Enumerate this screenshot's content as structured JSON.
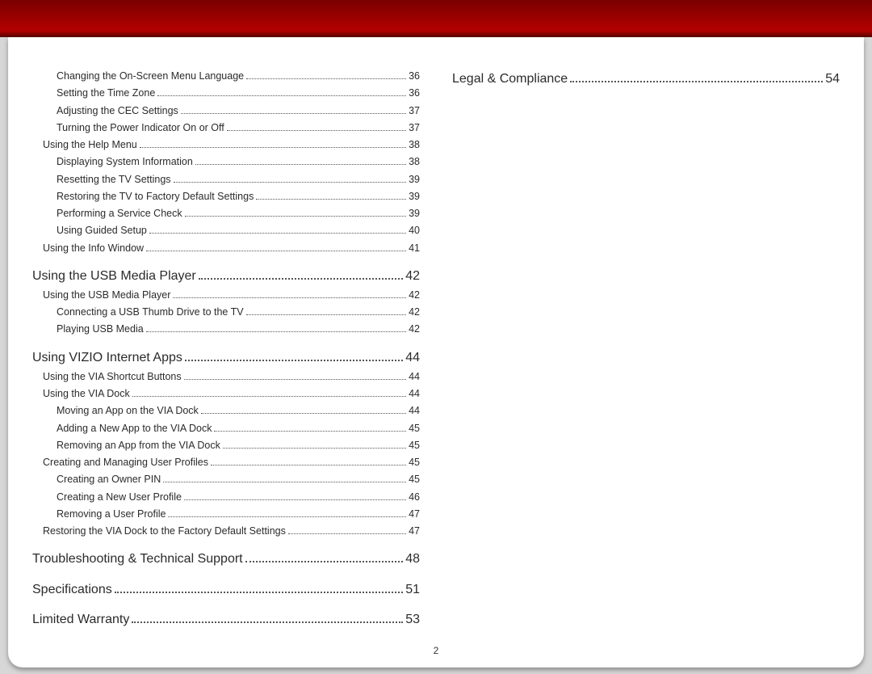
{
  "page_number": "2",
  "toc": [
    {
      "level": 3,
      "title": "Changing the On-Screen Menu Language",
      "page": "36"
    },
    {
      "level": 3,
      "title": "Setting the Time Zone",
      "page": "36"
    },
    {
      "level": 3,
      "title": "Adjusting the CEC Settings",
      "page": "37"
    },
    {
      "level": 3,
      "title": "Turning the Power Indicator On or Off",
      "page": "37"
    },
    {
      "level": 2,
      "title": "Using the Help Menu",
      "page": "38"
    },
    {
      "level": 3,
      "title": "Displaying System Information",
      "page": "38"
    },
    {
      "level": 3,
      "title": "Resetting the TV Settings",
      "page": "39"
    },
    {
      "level": 3,
      "title": "Restoring the TV to Factory Default Settings",
      "page": "39"
    },
    {
      "level": 3,
      "title": "Performing a Service Check",
      "page": "39"
    },
    {
      "level": 3,
      "title": "Using Guided Setup",
      "page": "40"
    },
    {
      "level": 2,
      "title": "Using the Info Window",
      "page": "41"
    },
    {
      "level": 1,
      "title": "Using the USB Media Player",
      "page": "42"
    },
    {
      "level": 2,
      "title": "Using the USB Media Player",
      "page": "42"
    },
    {
      "level": 3,
      "title": "Connecting a USB Thumb Drive to the TV",
      "page": "42"
    },
    {
      "level": 3,
      "title": "Playing USB Media",
      "page": "42"
    },
    {
      "level": 1,
      "title": "Using VIZIO Internet Apps",
      "page": "44"
    },
    {
      "level": 2,
      "title": "Using the VIA Shortcut Buttons",
      "page": "44"
    },
    {
      "level": 2,
      "title": "Using the VIA Dock",
      "page": "44"
    },
    {
      "level": 3,
      "title": "Moving an App on the VIA Dock",
      "page": "44"
    },
    {
      "level": 3,
      "title": "Adding a New App to the VIA Dock",
      "page": "45"
    },
    {
      "level": 3,
      "title": "Removing an App from the VIA Dock",
      "page": "45"
    },
    {
      "level": 2,
      "title": "Creating and Managing User Profiles",
      "page": "45"
    },
    {
      "level": 3,
      "title": "Creating an Owner PIN",
      "page": "45"
    },
    {
      "level": 3,
      "title": "Creating a New User Profile",
      "page": "46"
    },
    {
      "level": 3,
      "title": "Removing a User Profile",
      "page": "47"
    },
    {
      "level": 2,
      "title": "Restoring the VIA Dock to the Factory Default Settings",
      "page": "47"
    },
    {
      "level": 1,
      "title": "Troubleshooting & Technical Support",
      "page": "48"
    },
    {
      "level": 1,
      "title": "Specifications",
      "page": "51"
    },
    {
      "level": 1,
      "title": "Limited Warranty",
      "page": "53"
    },
    {
      "level": 1,
      "title": "Legal & Compliance",
      "page": "54"
    }
  ]
}
